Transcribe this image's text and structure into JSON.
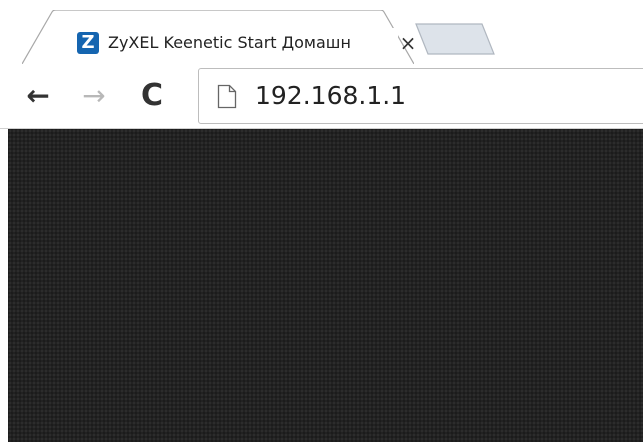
{
  "browser": {
    "tab": {
      "title": "ZyXEL Keenetic Start Домашн",
      "favicon_letter": "Z",
      "close_glyph": "×",
      "favicon_color": "#1565b0"
    },
    "toolbar": {
      "back_glyph": "←",
      "forward_glyph": "→",
      "reload_glyph": "C",
      "address": "192.168.1.1",
      "page_icon": "document-icon"
    }
  },
  "page": {
    "background_color": "#222222"
  }
}
